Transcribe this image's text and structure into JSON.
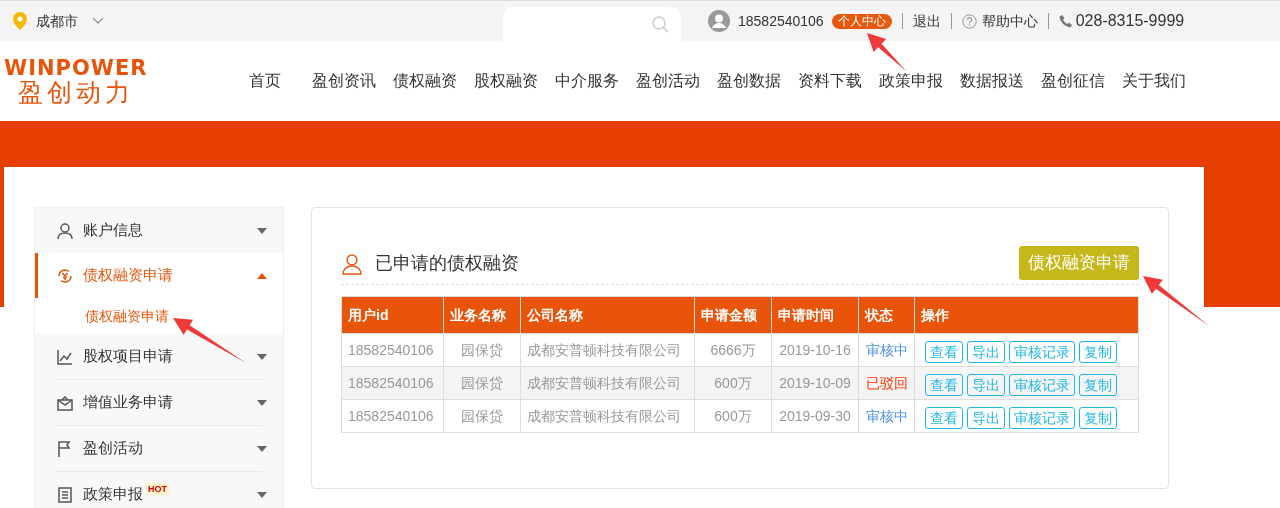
{
  "top_bar": {
    "city": "成都市",
    "user_id": "18582540106",
    "user_badge": "个人中心",
    "links": [
      {
        "label": "退出",
        "kind": "plain"
      },
      {
        "label": "帮助中心",
        "kind": "help"
      }
    ],
    "phone": "028-8315-9999"
  },
  "logo": {
    "latin": "WINPOWER",
    "chinese": "盈创动力"
  },
  "nav": [
    "首页",
    "盈创资讯",
    "债权融资",
    "股权融资",
    "中介服务",
    "盈创活动",
    "盈创数据",
    "资料下载",
    "政策申报",
    "数据报送",
    "盈创征信",
    "关于我们"
  ],
  "sidebar": {
    "items": [
      {
        "label": "账户信息",
        "kind": "user",
        "selected": false,
        "expanded": false
      },
      {
        "label": "债权融资申请",
        "kind": "yuan",
        "selected": true,
        "expanded": true,
        "children": [
          {
            "label": "债权融资申请",
            "selected": true
          }
        ]
      },
      {
        "label": "股权项目申请",
        "kind": "chart",
        "selected": false,
        "expanded": false
      },
      {
        "label": "增值业务申请",
        "kind": "box",
        "selected": false,
        "expanded": false
      },
      {
        "label": "盈创活动",
        "kind": "flag",
        "selected": false,
        "expanded": false
      },
      {
        "label": "政策申报",
        "kind": "list",
        "selected": false,
        "expanded": false,
        "badge": "HOT"
      }
    ]
  },
  "main": {
    "title": "已申请的债权融资",
    "apply_button": "债权融资申请",
    "table": {
      "columns": [
        "用户id",
        "业务名称",
        "公司名称",
        "申请金额",
        "申请时间",
        "状态",
        "操作"
      ],
      "rows": [
        {
          "user_id": "18582540106",
          "business": "园保贷",
          "company": "成都安普顿科技有限公司",
          "amount": "6666万",
          "date": "2019-10-16",
          "status": "审核中",
          "color": "#4a90e2",
          "actions": [
            "查看",
            "导出",
            "审核记录",
            "复制"
          ]
        },
        {
          "user_id": "18582540106",
          "business": "园保贷",
          "company": "成都安普顿科技有限公司",
          "amount": "600万",
          "date": "2019-10-09",
          "status": "已驳回",
          "color": "#ff3300",
          "actions": [
            "查看",
            "导出",
            "审核记录",
            "复制"
          ]
        },
        {
          "user_id": "18582540106",
          "business": "园保贷",
          "company": "成都安普顿科技有限公司",
          "amount": "600万",
          "date": "2019-09-30",
          "status": "审核中",
          "color": "#4a90e2",
          "actions": [
            "查看",
            "导出",
            "审核记录",
            "复制"
          ]
        }
      ]
    }
  }
}
